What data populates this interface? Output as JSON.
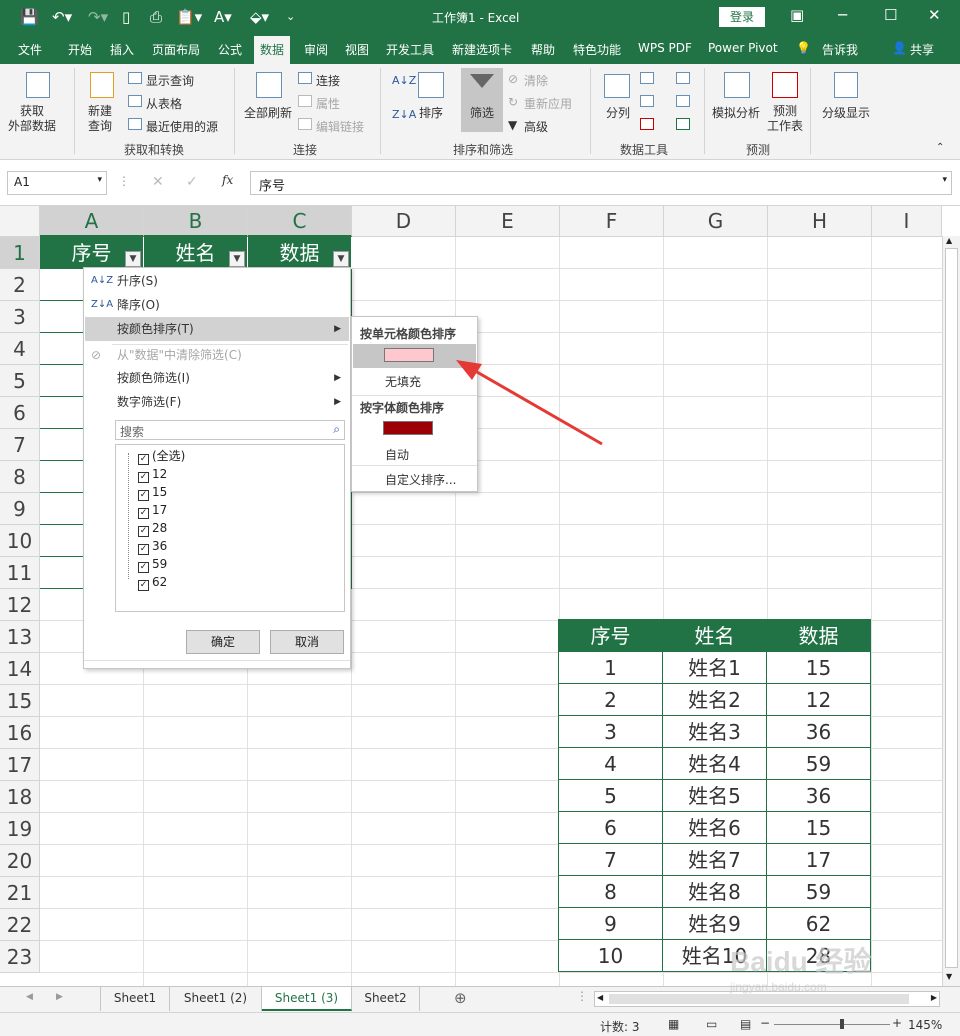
{
  "window": {
    "title": "工作簿1 - Excel",
    "login": "登录"
  },
  "tabs": [
    "文件",
    "开始",
    "插入",
    "页面布局",
    "公式",
    "数据",
    "审阅",
    "视图",
    "开发工具",
    "新建选项卡",
    "帮助",
    "特色功能",
    "WPS PDF",
    "Power Pivot",
    "告诉我",
    "共享"
  ],
  "ribbon": {
    "get_external": "获取\n外部数据",
    "new_query": "新建\n查询",
    "show_query": "显示查询",
    "from_table": "从表格",
    "recent_sources": "最近使用的源",
    "group_get": "获取和转换",
    "refresh_all": "全部刷新",
    "connections": "连接",
    "properties": "属性",
    "edit_links": "编辑链接",
    "group_conn": "连接",
    "sort": "排序",
    "filter": "筛选",
    "clear": "清除",
    "reapply": "重新应用",
    "advanced": "高级",
    "group_sort": "排序和筛选",
    "split": "分列",
    "group_tools": "数据工具",
    "whatif": "模拟分析",
    "forecast": "预测\n工作表",
    "group_forecast": "预测",
    "outline": "分级显示"
  },
  "formula_bar": {
    "name_box": "A1",
    "content": "序号"
  },
  "columns": [
    "A",
    "B",
    "C",
    "D",
    "E",
    "F",
    "G",
    "H",
    "I"
  ],
  "rows": [
    "1",
    "2",
    "3",
    "4",
    "5",
    "6",
    "7",
    "8",
    "9",
    "10",
    "11",
    "12",
    "13",
    "14",
    "15",
    "16",
    "17",
    "18",
    "19",
    "20",
    "21",
    "22",
    "23"
  ],
  "header_cells": [
    "序号",
    "姓名",
    "数据"
  ],
  "filter_menu": {
    "sort_asc": "升序(S)",
    "sort_desc": "降序(O)",
    "sort_by_color": "按颜色排序(T)",
    "clear_filter": "从\"数据\"中清除筛选(C)",
    "filter_by_color": "按颜色筛选(I)",
    "number_filter": "数字筛选(F)",
    "search_placeholder": "搜索",
    "checklist": [
      "(全选)",
      "12",
      "15",
      "17",
      "28",
      "36",
      "59",
      "62"
    ],
    "ok": "确定",
    "cancel": "取消"
  },
  "submenu": {
    "cell_color_title": "按单元格颜色排序",
    "cell_color_swatch": "#ffc7ce",
    "no_fill": "无填充",
    "font_color_title": "按字体颜色排序",
    "font_color_swatch": "#9c0006",
    "auto": "自动",
    "custom_sort": "自定义排序..."
  },
  "table": {
    "headers": [
      "序号",
      "姓名",
      "数据"
    ],
    "rows": [
      [
        "1",
        "姓名1",
        "15"
      ],
      [
        "2",
        "姓名2",
        "12"
      ],
      [
        "3",
        "姓名3",
        "36"
      ],
      [
        "4",
        "姓名4",
        "59"
      ],
      [
        "5",
        "姓名5",
        "36"
      ],
      [
        "6",
        "姓名6",
        "15"
      ],
      [
        "7",
        "姓名7",
        "17"
      ],
      [
        "8",
        "姓名8",
        "59"
      ],
      [
        "9",
        "姓名9",
        "62"
      ],
      [
        "10",
        "姓名10",
        "28"
      ]
    ]
  },
  "sheets": [
    "Sheet1",
    "Sheet1 (2)",
    "Sheet1 (3)",
    "Sheet2"
  ],
  "active_sheet": "Sheet1 (3)",
  "status": {
    "count": "计数: 3",
    "zoom": "145%"
  },
  "watermark": "Baidu 经验",
  "watermark_url": "jingyan.baidu.com",
  "colors": {
    "accent": "#217346",
    "arrow": "#e53935"
  }
}
